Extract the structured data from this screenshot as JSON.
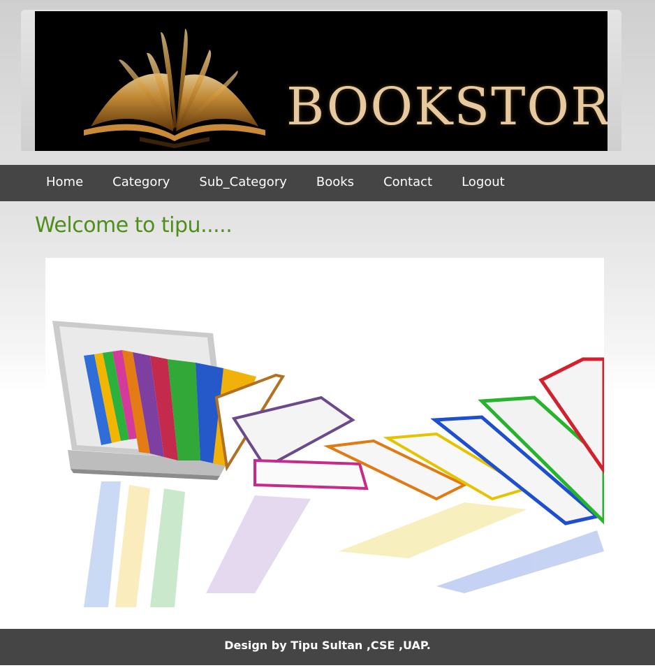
{
  "banner": {
    "brand_text": "BOOKSTORE",
    "logo_icon": "open-book-icon"
  },
  "nav": {
    "items": [
      {
        "label": "Home"
      },
      {
        "label": "Category"
      },
      {
        "label": "Sub_Category"
      },
      {
        "label": "Books"
      },
      {
        "label": "Contact"
      },
      {
        "label": "Logout"
      }
    ]
  },
  "main": {
    "welcome": "Welcome to tipu....."
  },
  "hero": {
    "illustration": "laptop-with-books-illustration"
  },
  "footer": {
    "credit": "Design by Tipu Sultan ,CSE ,UAP."
  },
  "colors": {
    "nav_bg": "#454545",
    "welcome_text": "#4e8f1a",
    "brand_text": "#e7c9a0"
  }
}
